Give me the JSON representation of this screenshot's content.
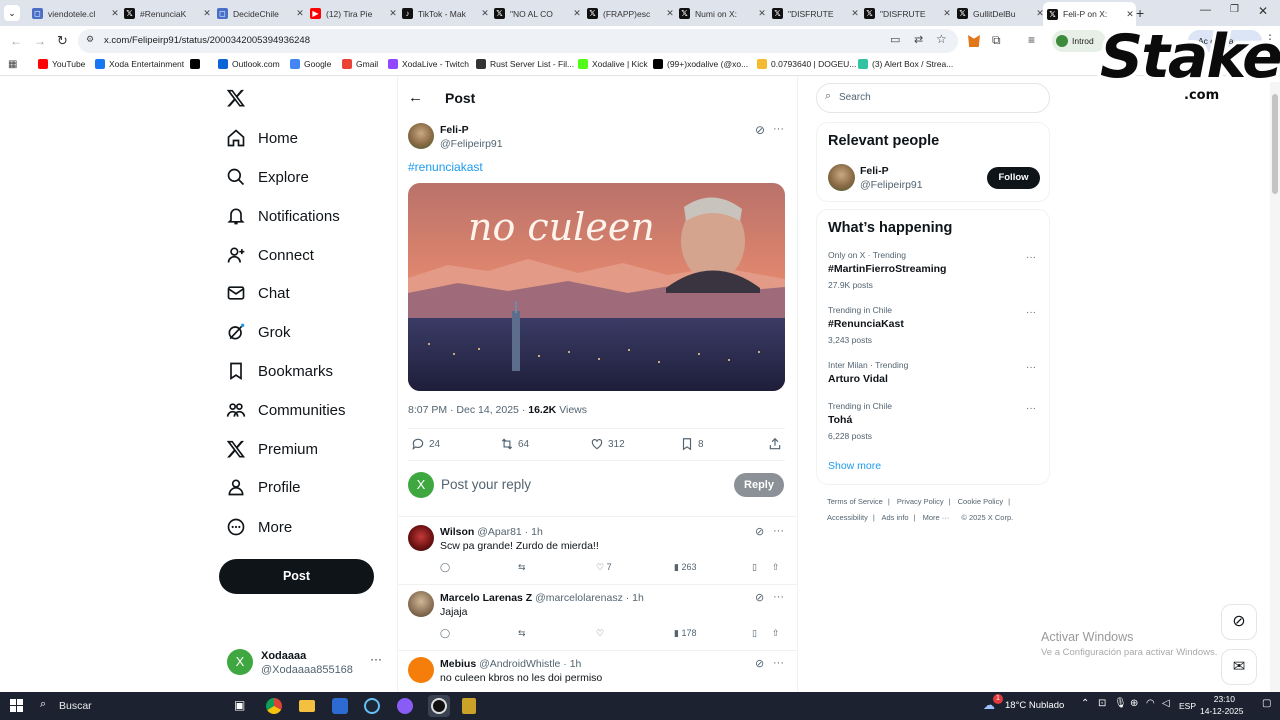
{
  "browser": {
    "tabs": [
      {
        "label": "viendotele.cl",
        "icon": "site-icon"
      },
      {
        "label": "#RenunciaK",
        "icon": "x-logo-icon"
      },
      {
        "label": "DecideChile",
        "icon": "site-icon"
      },
      {
        "label": "(12) Tira Pie",
        "icon": "youtube-icon"
      },
      {
        "label": "TikTok - Mak",
        "icon": "tiktok-icon"
      },
      {
        "label": "\"NO AL CO",
        "icon": "x-logo-icon"
      },
      {
        "label": "(FRAPP)esc",
        "icon": "x-logo-icon"
      },
      {
        "label": "Numi on X:",
        "icon": "x-logo-icon"
      },
      {
        "label": "\"DISFRUTE",
        "icon": "x-logo-icon"
      },
      {
        "label": "\"DISFRUTE",
        "icon": "x-logo-icon"
      },
      {
        "label": "GullitDelBu",
        "icon": "x-logo-icon"
      },
      {
        "label": "Feli-P on X:",
        "icon": "x-logo-icon"
      }
    ],
    "url": "x.com/Felipeirp91/status/2000342005394936248",
    "profile_chip": "Introd",
    "profile_chip_2": "Ac",
    "profile_chip_3": "esaria",
    "bookmarks": [
      {
        "label": "YouTube",
        "color": "#ff0000"
      },
      {
        "label": "Xoda Entertainment",
        "color": "#1877f2"
      },
      {
        "label": "",
        "color": "#000000"
      },
      {
        "label": "Outlook.com",
        "color": "#0a64d6"
      },
      {
        "label": "Google",
        "color": "#4285f4"
      },
      {
        "label": "Gmail",
        "color": "#ea4335"
      },
      {
        "label": "XodaLive - Twitch",
        "color": "#9146ff"
      },
      {
        "label": "Rust Server List - Fil...",
        "color": "#333333"
      },
      {
        "label": "Xodalive | Kick",
        "color": "#53fc18"
      },
      {
        "label": "(99+)xodalive (@xo...",
        "color": "#000000"
      },
      {
        "label": "0.0793640 | DOGEU...",
        "color": "#f3ba2f"
      },
      {
        "label": "(3) Alert Box / Strea...",
        "color": "#31c3a2"
      }
    ]
  },
  "overlay": {
    "brand": "Stake",
    "brand_suffix": ".com"
  },
  "sidebar": {
    "items": [
      {
        "label": "Home",
        "icon": "home-icon"
      },
      {
        "label": "Explore",
        "icon": "search-icon"
      },
      {
        "label": "Notifications",
        "icon": "bell-icon"
      },
      {
        "label": "Connect",
        "icon": "add-person-icon"
      },
      {
        "label": "Chat",
        "icon": "mail-icon"
      },
      {
        "label": "Grok",
        "icon": "grok-icon"
      },
      {
        "label": "Bookmarks",
        "icon": "bookmark-icon"
      },
      {
        "label": "Communities",
        "icon": "communities-icon"
      },
      {
        "label": "Premium",
        "icon": "x-logo-icon"
      },
      {
        "label": "Profile",
        "icon": "person-icon"
      },
      {
        "label": "More",
        "icon": "more-circle-icon"
      }
    ],
    "post_button": "Post",
    "account": {
      "name": "Xodaaaa",
      "handle": "@Xodaaaa855168",
      "avatar_letter": "X"
    }
  },
  "main": {
    "header": "Post",
    "tweet": {
      "author": "Feli-P",
      "handle": "@Felipeirp91",
      "hashtag": "#renunciakast",
      "image_text": "no culeen",
      "time": "8:07 PM · Dec 14, 2025 · ",
      "views_count": "16.2K",
      "views_label": "Views",
      "replies": "24",
      "reposts": "64",
      "likes": "312",
      "bookmarks": "8"
    },
    "reply_box": {
      "avatar_letter": "X",
      "placeholder": "Post your reply",
      "button": "Reply"
    },
    "comments": [
      {
        "name": "Wilson",
        "handle": "@Apar81 · 1h",
        "text": "Scw pa grande! Zurdo de mierda!!",
        "likes": "7",
        "views": "263"
      },
      {
        "name": "Marcelo Larenas Z",
        "handle": "@marcelolarenasz · 1h",
        "text": "Jajaja",
        "likes": "",
        "views": "178"
      },
      {
        "name": "Mebius",
        "handle": "@AndroidWhistle · 1h",
        "text": "no culeen kbros no les doi permiso"
      }
    ]
  },
  "right": {
    "search_placeholder": "Search",
    "relevant": {
      "title": "Relevant people",
      "name": "Feli-P",
      "handle": "@Felipeirp91",
      "follow": "Follow"
    },
    "happening": {
      "title": "What’s happening",
      "trends": [
        {
          "context": "Only on X · Trending",
          "name": "#MartinFierroStreaming",
          "count": "27.9K posts"
        },
        {
          "context": "Trending in Chile",
          "name": "#RenunciaKast",
          "count": "3,243 posts"
        },
        {
          "context": "Inter Milan · Trending",
          "name": "Arturo Vidal",
          "count": ""
        },
        {
          "context": "Trending in Chile",
          "name": "Tohá",
          "count": "6,228 posts"
        }
      ],
      "show_more": "Show more"
    },
    "footer": {
      "line1": [
        "Terms of Service",
        "Privacy Policy",
        "Cookie Policy"
      ],
      "line2": [
        "Accessibility",
        "Ads info",
        "More ···",
        "© 2025 X Corp."
      ]
    }
  },
  "watermark": {
    "title": "Activar Windows",
    "subtitle": "Ve a Configuración para activar Windows."
  },
  "taskbar": {
    "search": "Buscar",
    "weather": "18°C  Nublado",
    "lang": "ESP",
    "time": "23:10",
    "date": "14-12-2025",
    "notification_badge": "1"
  }
}
